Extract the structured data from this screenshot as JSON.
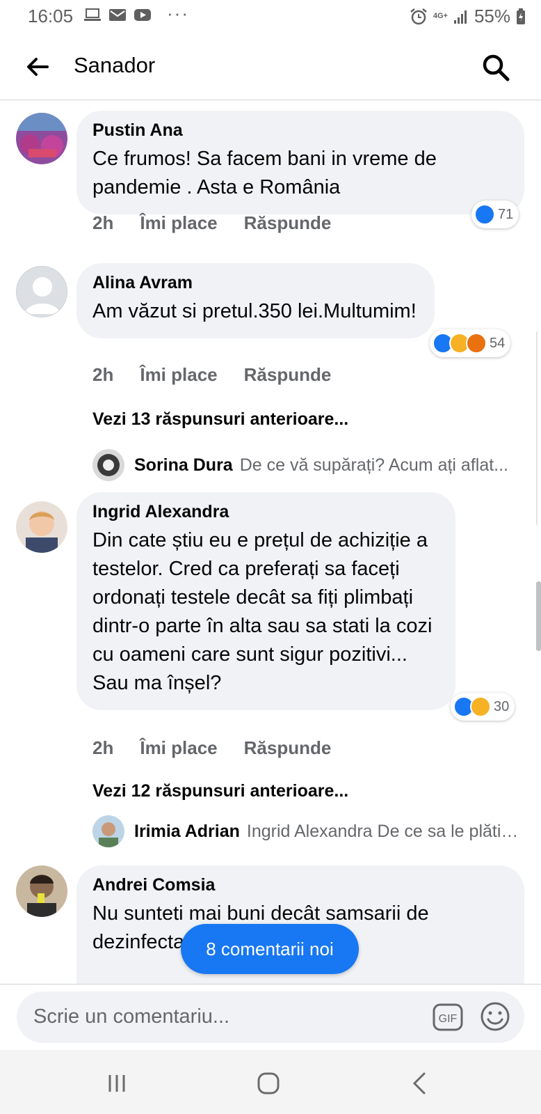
{
  "status_bar": {
    "time": "16:05",
    "dots": "···",
    "network": "4G+",
    "battery": "55%"
  },
  "header": {
    "title": "Sanador"
  },
  "comments": [
    {
      "author": "Pustin Ana",
      "text": "Ce frumos! Sa facem bani in vreme de pandemie . Asta e România",
      "time": "2h",
      "like_label": "Îmi place",
      "reply_label": "Răspunde",
      "reaction_count": "71",
      "reactions": [
        "like"
      ]
    },
    {
      "author": "Alina Avram",
      "text": "Am văzut si pretul.350 lei.Multumim!",
      "time": "2h",
      "like_label": "Îmi place",
      "reply_label": "Răspunde",
      "reaction_count": "54",
      "reactions": [
        "like",
        "haha",
        "angry"
      ],
      "more_replies": "Vezi 13 răspunsuri anterioare...",
      "reply_preview": {
        "author": "Sorina Dura",
        "text": "De ce vă supărați? Acum ați aflat..."
      }
    },
    {
      "author": "Ingrid Alexandra",
      "text": "Din cate știu eu e prețul de achiziție a testelor. Cred ca preferați sa faceți ordonați testele decât sa fiți plimbați dintr-o parte în alta sau sa stati la cozi cu oameni care sunt sigur pozitivi... Sau ma înșel?",
      "time": "2h",
      "like_label": "Îmi place",
      "reply_label": "Răspunde",
      "reaction_count": "30",
      "reactions": [
        "like",
        "haha"
      ],
      "more_replies": "Vezi 12 răspunsuri anterioare...",
      "reply_preview": {
        "author": "Irimia Adrian",
        "text": "Ingrid Alexandra De ce sa le plătim..."
      }
    },
    {
      "author": "Andrei Comsia",
      "text": "Nu sunteti mai buni decât samsarii de dezinfectante de pe"
    }
  ],
  "new_comments_pill": "8 comentarii noi",
  "composer": {
    "placeholder": "Scrie un comentariu...",
    "gif_label": "GIF"
  },
  "colors": {
    "accent": "#1877f2",
    "bubble": "#f0f2f5",
    "secondary_text": "#65676b"
  }
}
